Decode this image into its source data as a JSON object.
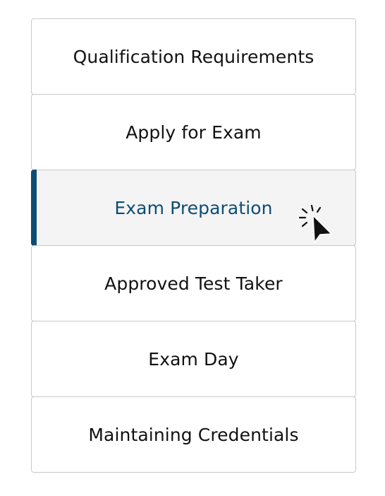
{
  "nav": {
    "items": [
      {
        "label": "Qualification Requirements"
      },
      {
        "label": "Apply for Exam"
      },
      {
        "label": "Exam Preparation",
        "active": true
      },
      {
        "label": "Approved Test Taker"
      },
      {
        "label": "Exam Day"
      },
      {
        "label": "Maintaining Credentials"
      }
    ]
  },
  "colors": {
    "accent": "#0e4d73",
    "active_background": "#f4f4f4",
    "border": "#c9c9c9",
    "text": "#111111"
  },
  "icons": {
    "cursor": "click-cursor-icon"
  }
}
